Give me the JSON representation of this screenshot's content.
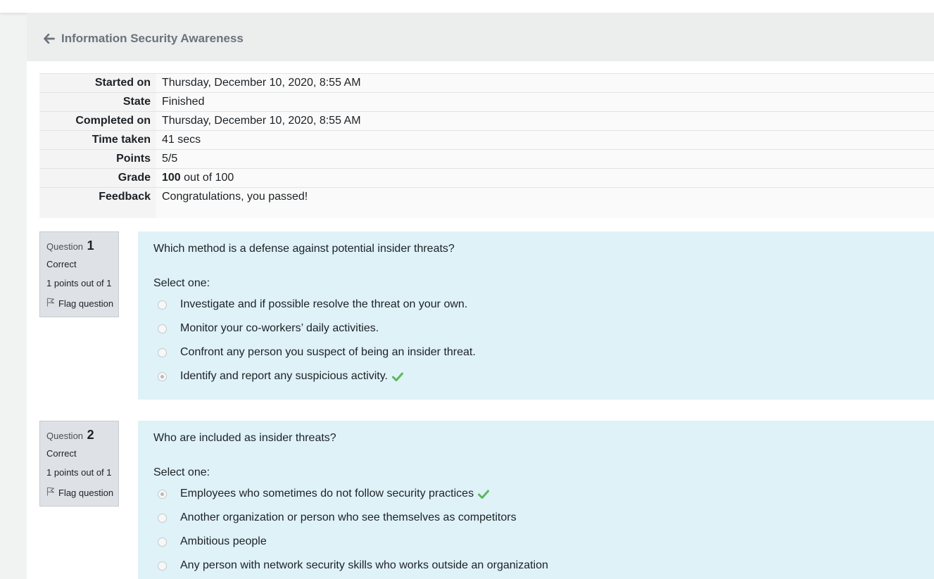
{
  "header": {
    "back_label": "Information Security Awareness"
  },
  "summary": {
    "rows": [
      {
        "label": "Started on",
        "value": "Thursday, December 10, 2020, 8:55 AM"
      },
      {
        "label": "State",
        "value": "Finished"
      },
      {
        "label": "Completed on",
        "value": "Thursday, December 10, 2020, 8:55 AM"
      },
      {
        "label": "Time taken",
        "value": "41 secs"
      },
      {
        "label": "Points",
        "value": "5/5"
      },
      {
        "label": "Grade",
        "value_bold": "100",
        "value": " out of 100"
      },
      {
        "label": "Feedback",
        "value": "Congratulations, you passed!"
      }
    ]
  },
  "questions": [
    {
      "label": "Question",
      "number": "1",
      "status": "Correct",
      "points": "1 points out of 1",
      "flag_label": "Flag question",
      "text": "Which method is a defense against potential insider threats?",
      "prompt": "Select one:",
      "answers": [
        {
          "text": "Investigate and if possible resolve the threat on your own.",
          "selected": false
        },
        {
          "text": "Monitor your co-workers’ daily activities.",
          "selected": false
        },
        {
          "text": "Confront any person you suspect of being an insider threat.",
          "selected": false
        },
        {
          "text": "Identify and report any suspicious activity.",
          "selected": true
        }
      ]
    },
    {
      "label": "Question",
      "number": "2",
      "status": "Correct",
      "points": "1 points out of 1",
      "flag_label": "Flag question",
      "text": "Who are included as insider threats?",
      "prompt": "Select one:",
      "answers": [
        {
          "text": "Employees who sometimes do not follow security practices",
          "selected": true
        },
        {
          "text": "Another organization or person who see themselves as competitors",
          "selected": false
        },
        {
          "text": "Ambitious people",
          "selected": false
        },
        {
          "text": "Any person with network security skills who works outside an organization",
          "selected": false
        }
      ]
    }
  ],
  "colors": {
    "question_bg": "#def2f8",
    "info_bg": "#dee2e6",
    "correct_check": "#5cb85c",
    "header_text": "#6a737b"
  },
  "icons": {
    "back": "arrow-left-icon",
    "flag": "flag-icon",
    "correct": "check-icon",
    "radio": "radio-icon"
  }
}
